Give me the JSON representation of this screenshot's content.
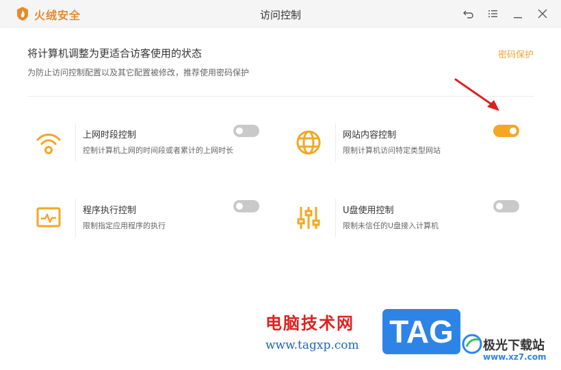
{
  "app": {
    "name": "火绒安全",
    "window_title": "访问控制"
  },
  "window_controls": [
    {
      "name": "back-icon"
    },
    {
      "name": "menu-icon"
    },
    {
      "name": "minimize-icon"
    },
    {
      "name": "close-icon"
    }
  ],
  "header": {
    "title": "将计算机调整为更适合访客使用的状态",
    "subtitle": "为防止访问控制配置以及其它配置被修改，推荐使用密码保护",
    "password_link": "密码保护"
  },
  "features": [
    {
      "id": "online-time",
      "icon": "wifi-icon",
      "title": "上网时段控制",
      "desc": "控制计算机上网的时间段或者累计的上网时长",
      "enabled": false
    },
    {
      "id": "website",
      "icon": "globe-icon",
      "title": "网站内容控制",
      "desc": "限制计算机访问特定类型网站",
      "enabled": true
    },
    {
      "id": "program",
      "icon": "monitor-pulse-icon",
      "title": "程序执行控制",
      "desc": "限制指定应用程序的执行",
      "enabled": false
    },
    {
      "id": "usb",
      "icon": "sliders-icon",
      "title": "U盘使用控制",
      "desc": "限制未信任的U盘接入计算机",
      "enabled": false
    }
  ],
  "colors": {
    "accent": "#f5a623",
    "toggle_off": "#c9c9c9",
    "link": "#f0a43a",
    "annotation_arrow": "#e02020"
  },
  "watermark": {
    "site_cn": "电脑技术网",
    "site_url": "www.tagxp.com",
    "badge": "TAG",
    "brand_cn": "极光下载站",
    "brand_url": "www.xz7.com"
  }
}
